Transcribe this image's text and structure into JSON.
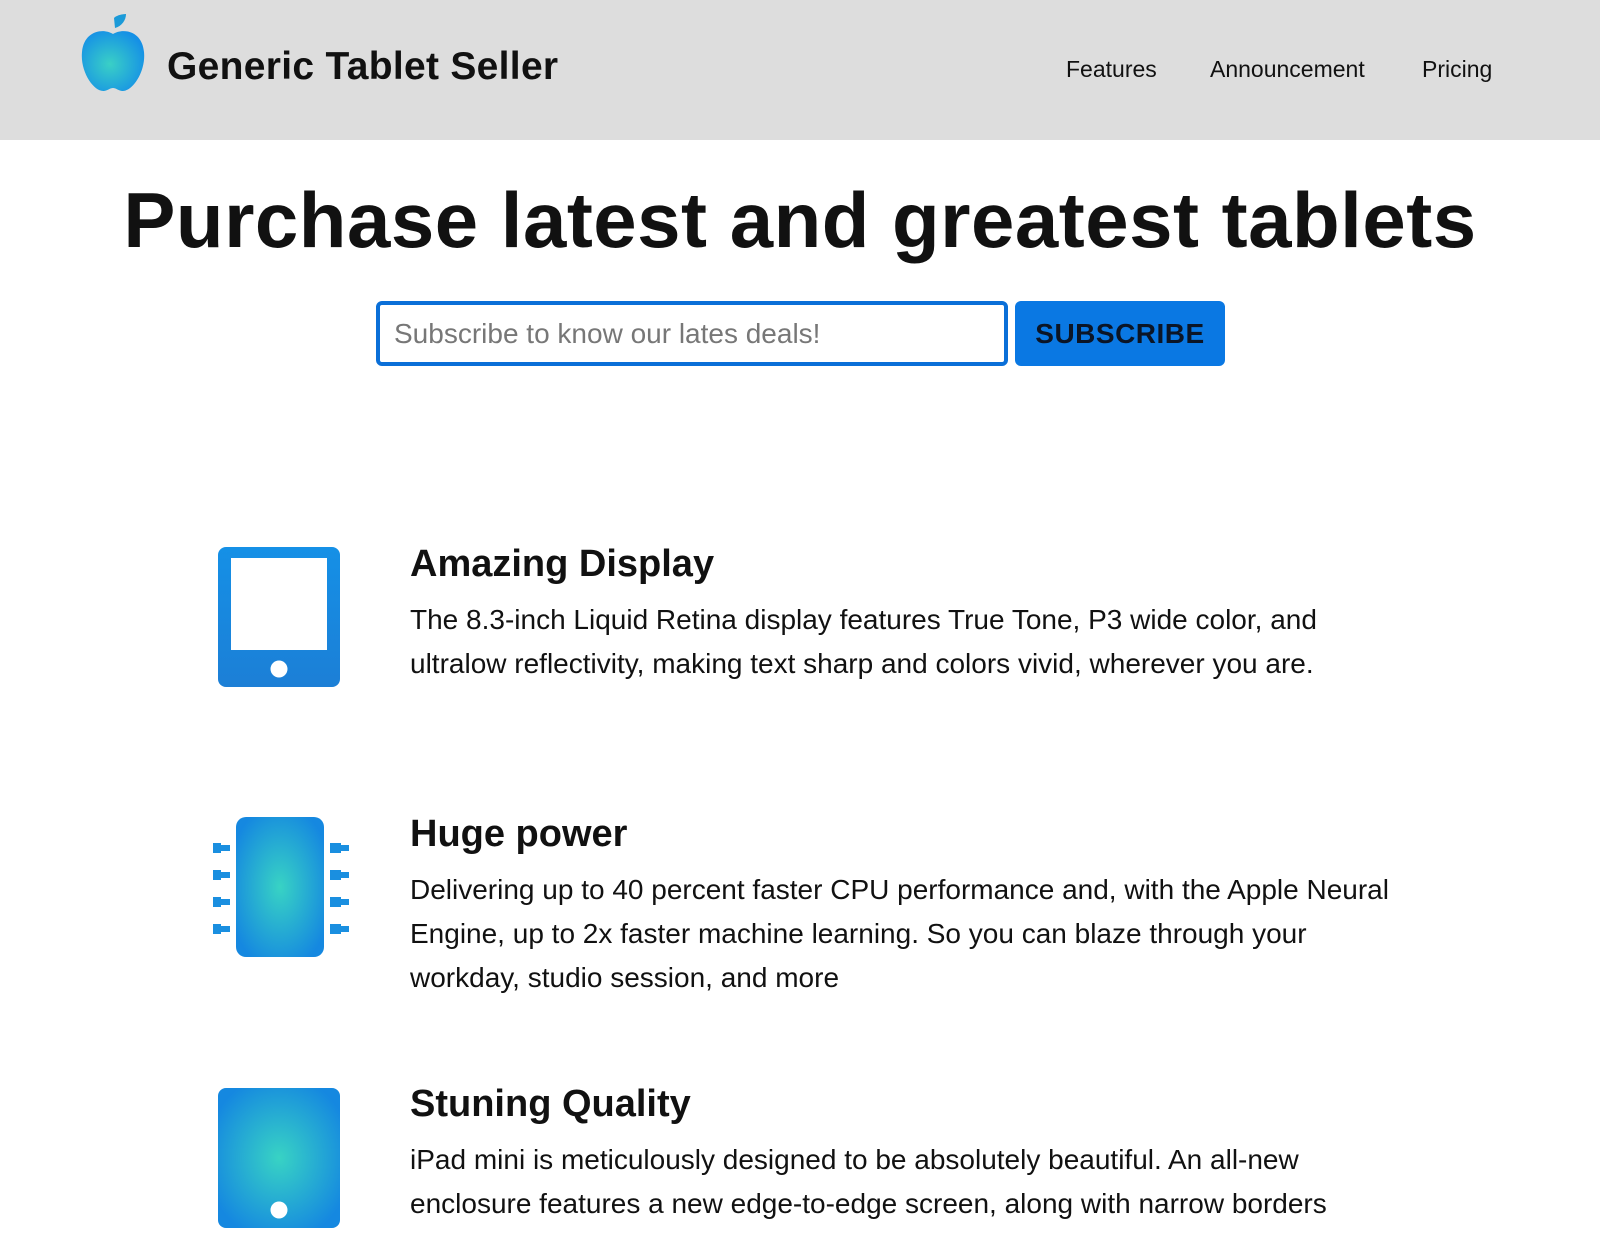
{
  "header": {
    "brand": "Generic Tablet Seller",
    "logo_icon": "apple-icon",
    "nav": [
      "Features",
      "Announcement",
      "Pricing"
    ],
    "background": "#dddddd"
  },
  "hero": {
    "title": "Purchase latest and greatest tablets",
    "subscribe_placeholder": "Subscribe to know our lates deals!",
    "subscribe_button": "SUBSCRIBE"
  },
  "features": [
    {
      "icon": "tablet-icon",
      "title": "Amazing Display",
      "text": "The 8.3-inch Liquid Retina display features True Tone, P3 wide color, and ultralow reflectivity, making text sharp and colors vivid, wherever you are."
    },
    {
      "icon": "chip-icon",
      "title": "Huge power",
      "text": "Delivering up to 40 percent faster CPU performance and, with the Apple Neural Engine, up to 2x faster machine learning. So you can blaze through your workday, studio session, and more"
    },
    {
      "icon": "tablet-glow-icon",
      "title": "Stuning Quality",
      "text": "iPad mini is meticulously designed to be absolutely beautiful. An all-new enclosure features a new edge-to-edge screen, along with narrow borders"
    }
  ],
  "colors": {
    "accent": "#0a78e3",
    "icon_blue": "#1a8fe0",
    "icon_teal": "#30c8c8"
  }
}
